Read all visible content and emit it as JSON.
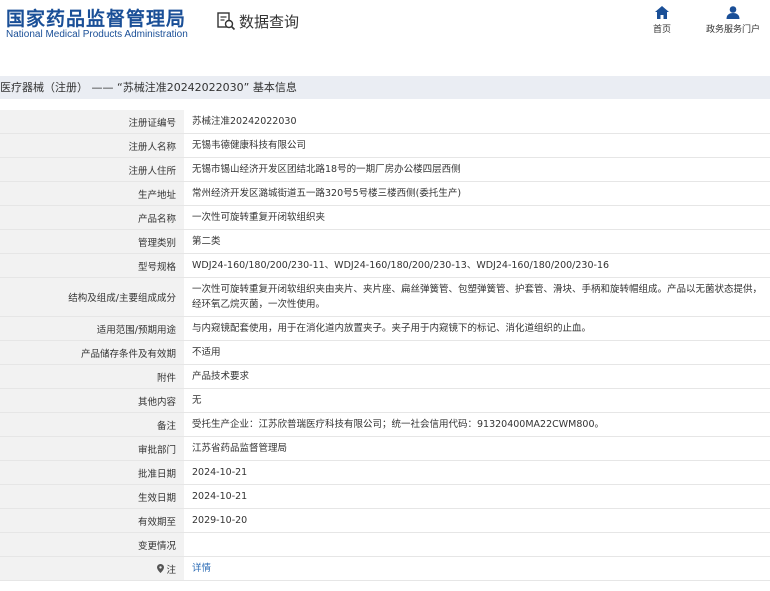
{
  "header": {
    "logo_cn": "国家药品监督管理局",
    "logo_en": "National Medical Products Administration",
    "query_label": "数据查询",
    "nav": [
      {
        "label": "首页",
        "icon": "home-icon"
      },
      {
        "label": "政务服务门户",
        "icon": "user-icon"
      }
    ]
  },
  "breadcrumb": "医疗器械（注册） —— “苏械注准20242022030” 基本信息",
  "rows": [
    {
      "label": "注册证编号",
      "value": "苏械注准20242022030"
    },
    {
      "label": "注册人名称",
      "value": "无锡韦德健康科技有限公司"
    },
    {
      "label": "注册人住所",
      "value": "无锡市锡山经济开发区团结北路18号的一期厂房办公楼四层西侧"
    },
    {
      "label": "生产地址",
      "value": "常州经济开发区潞城街道五一路320号5号楼三楼西侧(委托生产)"
    },
    {
      "label": "产品名称",
      "value": "一次性可旋转重复开闭软组织夹"
    },
    {
      "label": "管理类别",
      "value": "第二类"
    },
    {
      "label": "型号规格",
      "value": "WDJ24-160/180/200/230-11、WDJ24-160/180/200/230-13、WDJ24-160/180/200/230-16"
    },
    {
      "label": "结构及组成/主要组成成分",
      "value": "一次性可旋转重复开闭软组织夹由夹片、夹片座、扁丝弹簧管、包塑弹簧管、护套管、滑块、手柄和旋转帽组成。产品以无菌状态提供，经环氧乙烷灭菌，一次性使用。"
    },
    {
      "label": "适用范围/预期用途",
      "value": "与内窥镜配套使用，用于在消化道内放置夹子。夹子用于内窥镜下的标记、消化道组织的止血。"
    },
    {
      "label": "产品储存条件及有效期",
      "value": "不适用"
    },
    {
      "label": "附件",
      "value": "产品技术要求"
    },
    {
      "label": "其他内容",
      "value": "无"
    },
    {
      "label": "备注",
      "value": "受托生产企业：江苏欣普瑞医疗科技有限公司；统一社会信用代码：91320400MA22CWM800。"
    },
    {
      "label": "审批部门",
      "value": "江苏省药品监督管理局"
    },
    {
      "label": "批准日期",
      "value": "2024-10-21"
    },
    {
      "label": "生效日期",
      "value": "2024-10-21"
    },
    {
      "label": "有效期至",
      "value": "2029-10-20"
    },
    {
      "label": "变更情况",
      "value": ""
    },
    {
      "label": "注",
      "value": "详情"
    }
  ],
  "colors": {
    "brand": "#1a4f97",
    "link": "#2a6ab4",
    "label_bg": "#f2f2f2",
    "crumb_bg": "#eaedf3"
  }
}
